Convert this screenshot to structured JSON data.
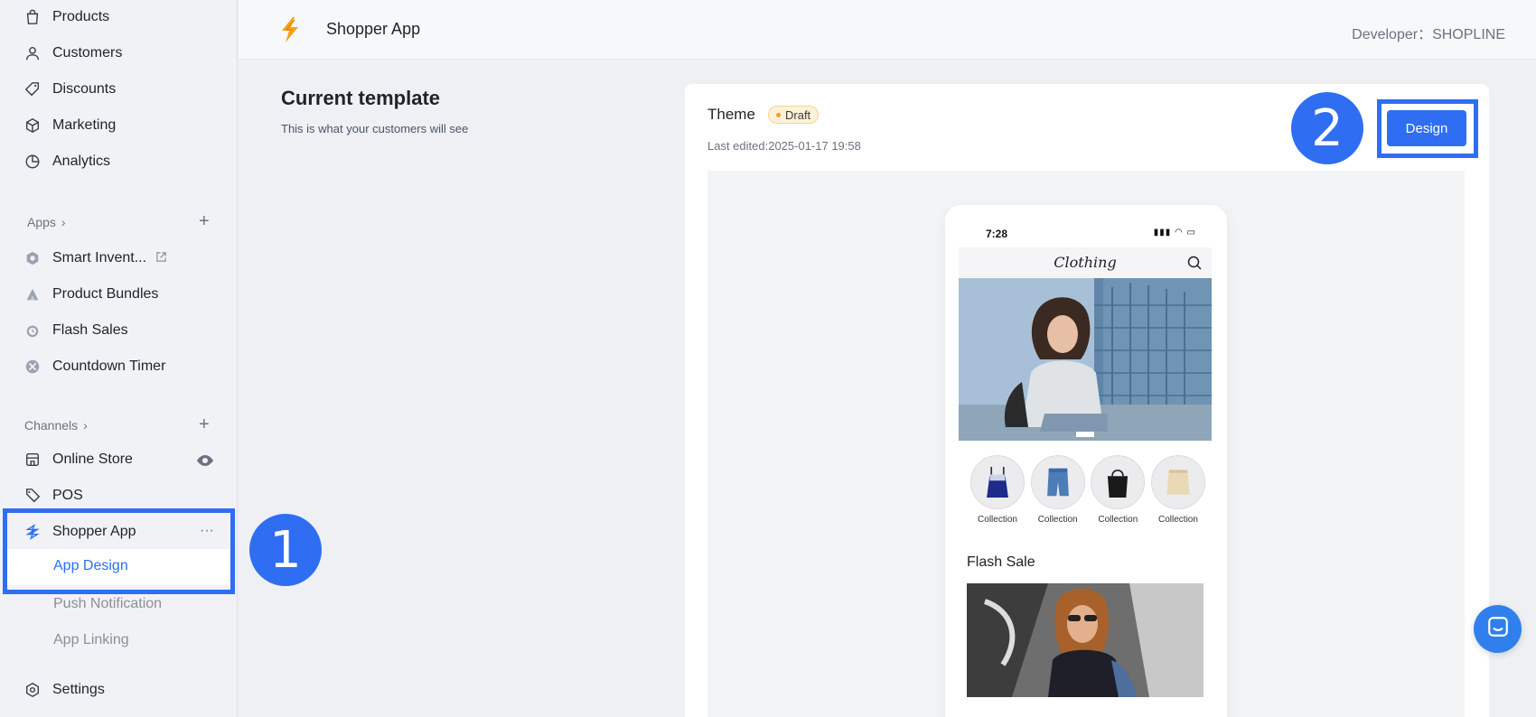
{
  "sidebar": {
    "nav": [
      {
        "label": "Products",
        "icon": "shopping-bag-icon"
      },
      {
        "label": "Customers",
        "icon": "person-icon"
      },
      {
        "label": "Discounts",
        "icon": "tag-icon"
      },
      {
        "label": "Marketing",
        "icon": "cube-icon"
      },
      {
        "label": "Analytics",
        "icon": "pie-chart-icon"
      }
    ],
    "apps_section": {
      "label": "Apps",
      "chevron": "›",
      "plus": "+"
    },
    "apps": [
      {
        "label": "Smart Invent...",
        "icon": "hexagon-app-icon",
        "external": "external-link-icon"
      },
      {
        "label": "Product Bundles",
        "icon": "bundle-icon"
      },
      {
        "label": "Flash Sales",
        "icon": "alarm-icon"
      },
      {
        "label": "Countdown Timer",
        "icon": "timer-icon"
      }
    ],
    "channels_section": {
      "label": "Channels",
      "chevron": "›",
      "plus": "+"
    },
    "channels": [
      {
        "label": "Online Store",
        "icon": "store-icon"
      },
      {
        "label": "POS",
        "icon": "pos-tag-icon"
      },
      {
        "label": "Shopper App",
        "icon": "shopper-app-icon",
        "more": "···"
      }
    ],
    "shopper_sub": [
      {
        "label": "App Design",
        "active": true
      },
      {
        "label": "Push Notification"
      },
      {
        "label": "App Linking"
      }
    ],
    "settings": {
      "label": "Settings",
      "icon": "settings-icon"
    }
  },
  "annotations": {
    "step1": "1",
    "step2": "2",
    "highlight_color": "#2f6ef2"
  },
  "header": {
    "title": "Shopper App",
    "developer": "Developer：SHOPLINE"
  },
  "main": {
    "title": "Current template",
    "subtitle": "This is what your customers will see"
  },
  "card": {
    "theme_label": "Theme",
    "status_badge": "Draft",
    "last_edited": "Last edited:2025-01-17 19:58",
    "design_button": "Design"
  },
  "phone": {
    "time": "7:28",
    "status_icons": "▮▮▮ ◠ ▭",
    "brand": "Clothing",
    "collections": [
      "Collection",
      "Collection",
      "Collection",
      "Collection"
    ],
    "flash_sale_title": "Flash Sale"
  },
  "colors": {
    "accent": "#2f6ef2",
    "sidebar_bg": "#f1f2f5",
    "page_bg": "#eef0f4"
  }
}
